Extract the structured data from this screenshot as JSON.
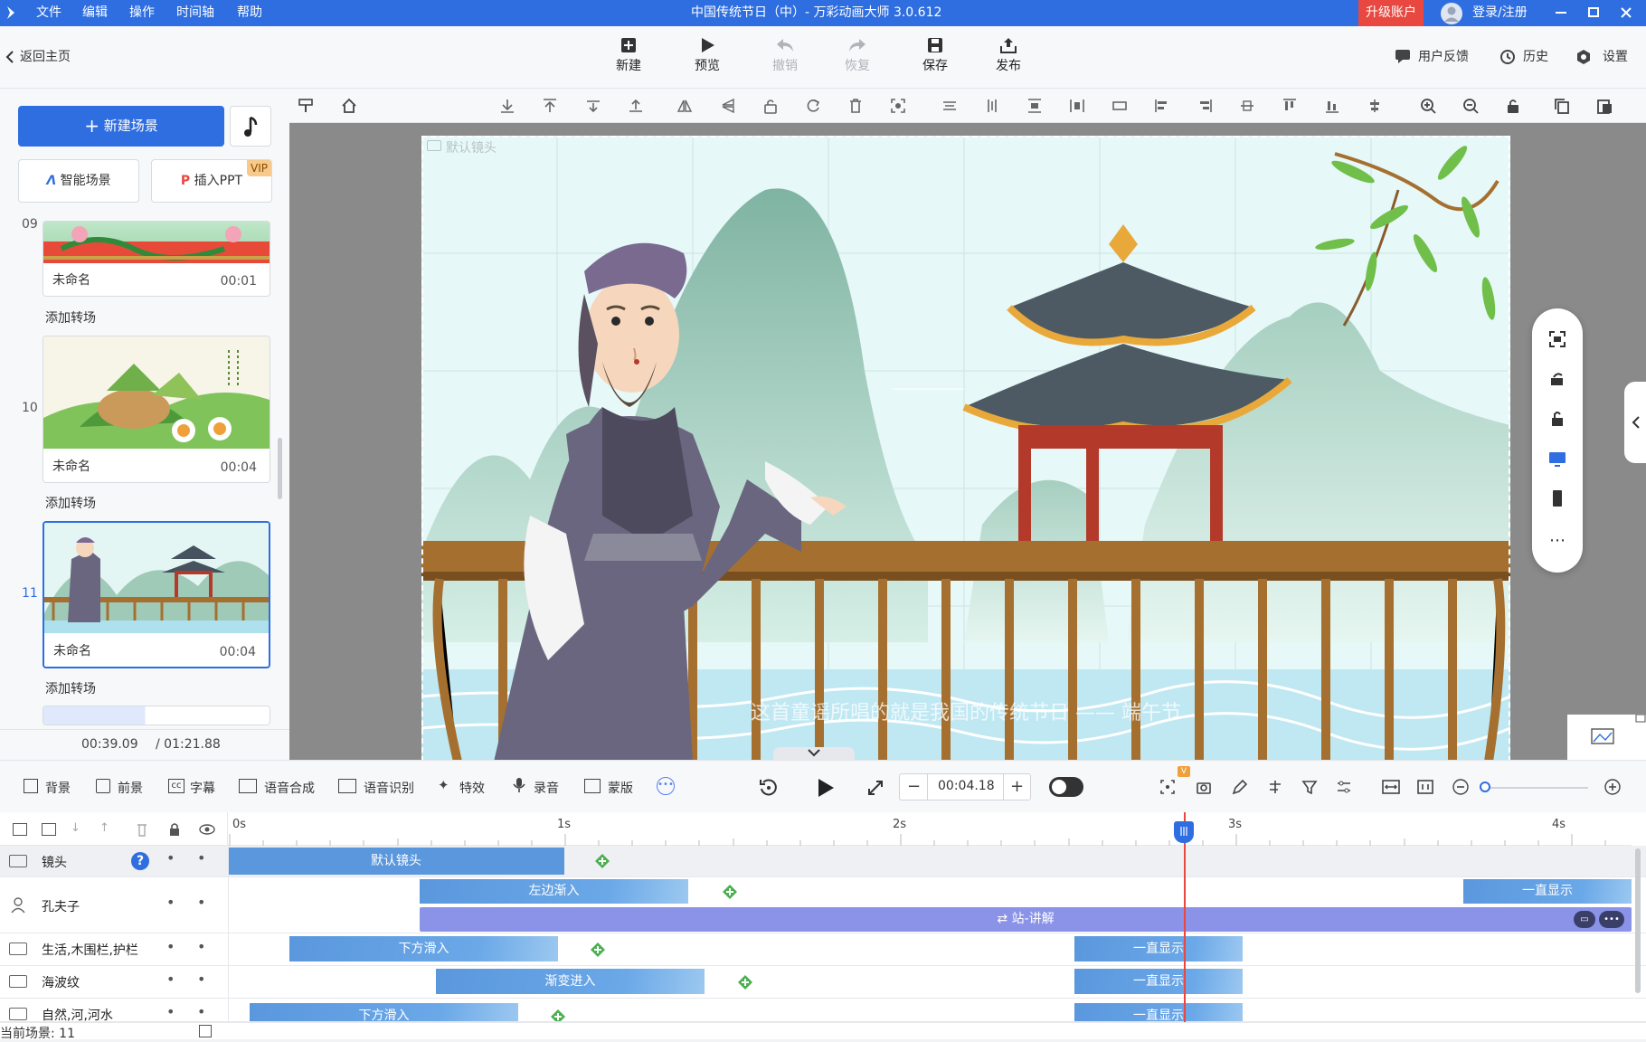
{
  "titlebar": {
    "menus": [
      "文件",
      "编辑",
      "操作",
      "时间轴",
      "帮助"
    ],
    "title": "中国传统节日（中）- 万彩动画大师 3.0.612",
    "upgrade": "升级账户",
    "login": "登录/注册"
  },
  "toolbar": {
    "back": "返回主页",
    "items": [
      {
        "label": "新建",
        "icon": "new-icon"
      },
      {
        "label": "预览",
        "icon": "play-icon"
      },
      {
        "label": "撤销",
        "icon": "undo-icon"
      },
      {
        "label": "恢复",
        "icon": "redo-icon"
      },
      {
        "label": "保存",
        "icon": "save-icon"
      },
      {
        "label": "发布",
        "icon": "publish-icon"
      }
    ],
    "right": {
      "feedback": "用户反馈",
      "history": "历史",
      "settings": "设置"
    }
  },
  "left": {
    "new_scene": "新建场景",
    "smart": "智能场景",
    "ppt": "插入PPT",
    "vip": "VIP",
    "scenes": [
      {
        "num": "09",
        "name": "未命名",
        "time": "00:01"
      },
      {
        "num": "10",
        "name": "未命名",
        "time": "00:04"
      },
      {
        "num": "11",
        "name": "未命名",
        "time": "00:04"
      }
    ],
    "transition": "添加转场",
    "current_time": "00:39.09",
    "total_time": "/ 01:21.88"
  },
  "stage": {
    "camera_label": "默认镜头",
    "subtitle": "这首童谣所唱的就是我国的传统节日 —— 端午节"
  },
  "bottombar": {
    "tools": [
      "背景",
      "前景",
      "字幕",
      "语音合成",
      "语音识别",
      "特效",
      "录音",
      "蒙版"
    ],
    "timecode": "00:04.18"
  },
  "timeline": {
    "ruler": [
      "0s",
      "1s",
      "2s",
      "3s",
      "4s"
    ],
    "status": "当前场景: 11",
    "tracks": [
      {
        "label": "镜头",
        "clips": [
          {
            "text": "默认镜头"
          }
        ]
      },
      {
        "label": "孔夫子",
        "clips": [
          {
            "text": "左边渐入"
          },
          {
            "text": "一直显示"
          },
          {
            "text": "站-讲解"
          }
        ]
      },
      {
        "label": "生活,木围栏,护栏",
        "clips": [
          {
            "text": "下方滑入"
          },
          {
            "text": "一直显示"
          }
        ]
      },
      {
        "label": "海波纹",
        "clips": [
          {
            "text": "渐变进入"
          },
          {
            "text": "一直显示"
          }
        ]
      },
      {
        "label": "自然,河,河水",
        "clips": [
          {
            "text": "下方滑入"
          },
          {
            "text": "一直显示"
          }
        ]
      }
    ]
  }
}
